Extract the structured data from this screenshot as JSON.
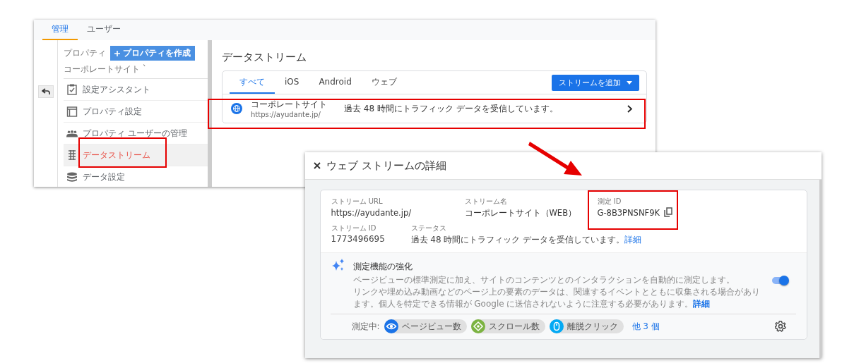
{
  "admin_screen": {
    "top_tabs": [
      {
        "label": "管理",
        "selected": true
      },
      {
        "label": "ユーザー",
        "selected": false
      }
    ],
    "property_label": "プロパティ",
    "create_property_button": "プロパティを作成",
    "property_name": "コーポレートサイト ˋ",
    "nav_items": [
      {
        "label": "設定アシスタント",
        "kind": "checklist",
        "selected": false
      },
      {
        "label": "プロパティ設定",
        "kind": "layout",
        "selected": false
      },
      {
        "label": "プロパティ ユーザーの管理",
        "kind": "people",
        "selected": false
      },
      {
        "label": "データストリーム",
        "kind": "stream",
        "selected": true
      },
      {
        "label": "データ設定",
        "kind": "database",
        "selected": false
      }
    ],
    "page_title": "データストリーム",
    "stream_tabs": [
      {
        "label": "すべて",
        "selected": true
      },
      {
        "label": "iOS",
        "selected": false
      },
      {
        "label": "Android",
        "selected": false
      },
      {
        "label": "ウェブ",
        "selected": false
      }
    ],
    "add_stream_button": "ストリームを追加",
    "streams": [
      {
        "name": "コーポレートサイト",
        "url": "https://ayudante.jp/",
        "status": "過去 48 時間にトラフィック データを受信しています。"
      }
    ]
  },
  "detail_screen": {
    "title": "ウェブ ストリームの詳細",
    "stream_url_label": "ストリーム URL",
    "stream_url": "https://ayudante.jp/",
    "stream_name_label": "ストリーム名",
    "stream_name": "コーポレートサイト（WEB）",
    "measurement_id_label": "測定 ID",
    "measurement_id": "G-8B3PNSNF9K",
    "stream_id_label": "ストリーム ID",
    "stream_id": "1773496695",
    "status_label": "ステータス",
    "status": "過去 48 時間にトラフィック データを受信しています。",
    "status_link": "詳細",
    "enhanced": {
      "title": "測定機能の強化",
      "on": true,
      "description": [
        "ページビューの標準測定に加え、サイトのコンテンツとのインタラクションを自動的に測定します。",
        "リンクや埋め込み動画などのページ上の要素のデータは、関連するイベントとともに収集される場合があります。個人を特定できる情報が Google に送信されないように注意する必要があります。"
      ],
      "link": "詳細",
      "measuring_label": "測定中:",
      "chips": [
        {
          "label": "ページビュー数",
          "kind": "eye",
          "color": "#1a73e8"
        },
        {
          "label": "スクロール数",
          "kind": "scroll",
          "color": "#7cb342"
        },
        {
          "label": "離脱クリック",
          "kind": "mouse",
          "color": "#03a9f4"
        }
      ],
      "more_link": "他 3 個"
    }
  }
}
